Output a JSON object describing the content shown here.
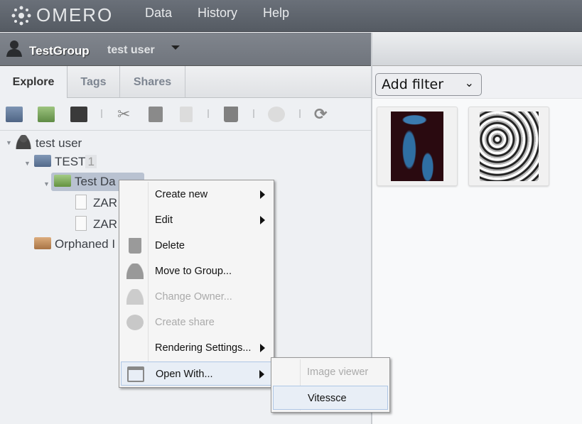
{
  "header": {
    "logo": "OMERO",
    "nav": [
      "Data",
      "History",
      "Help"
    ]
  },
  "groupbar": {
    "group": "TestGroup",
    "user": "test user"
  },
  "tabs": [
    {
      "label": "Explore",
      "active": true
    },
    {
      "label": "Tags"
    },
    {
      "label": "Shares"
    }
  ],
  "toolbar": [
    "new-project-icon",
    "new-dataset-icon",
    "new-screen-icon",
    "cut-icon",
    "copy-icon",
    "paste-icon",
    "delete-icon",
    "share-icon",
    "refresh-icon"
  ],
  "tree": {
    "user": "test user",
    "project": {
      "name": "TEST",
      "count": "1"
    },
    "dataset": {
      "name": "Test Da"
    },
    "images": [
      "ZAR",
      "ZAR"
    ],
    "orphaned": "Orphaned I"
  },
  "context_menu": {
    "items": [
      {
        "label": "Create new",
        "submenu": true
      },
      {
        "label": "Edit",
        "submenu": true
      },
      {
        "label": "Delete",
        "icon": "trash-icon"
      },
      {
        "label": "Move to Group...",
        "icon": "user-icon"
      },
      {
        "label": "Change Owner...",
        "icon": "user-icon",
        "disabled": true
      },
      {
        "label": "Create share",
        "icon": "globe-icon",
        "disabled": true
      },
      {
        "label": "Rendering Settings...",
        "submenu": true
      },
      {
        "label": "Open With...",
        "icon": "open-with-icon",
        "submenu": true,
        "highlighted": true
      }
    ]
  },
  "open_with_submenu": [
    {
      "label": "Image viewer",
      "disabled": true
    },
    {
      "label": "Vitessce",
      "highlighted": true
    }
  ],
  "filter": {
    "label": "Add filter"
  },
  "thumbnails": [
    "image-thumbnail-1",
    "image-thumbnail-2"
  ]
}
